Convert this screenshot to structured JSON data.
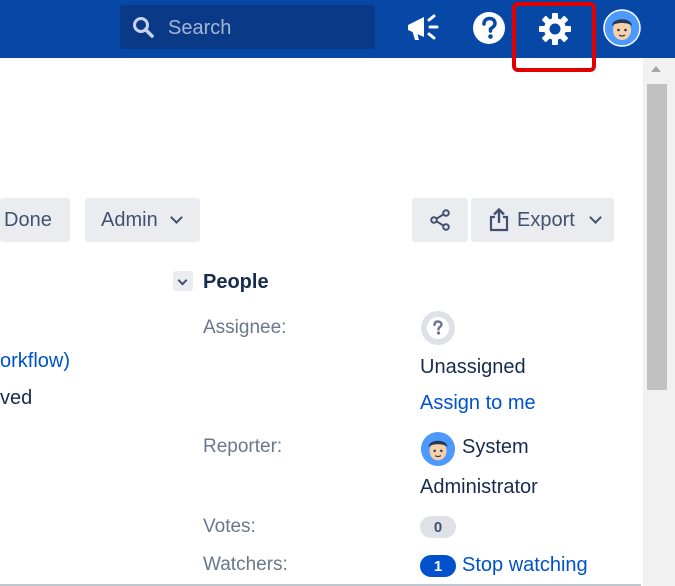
{
  "topbar": {
    "search": {
      "placeholder": "Search"
    },
    "icons": {
      "announcements": "megaphone-icon",
      "help": "help-icon",
      "settings": "gear-icon",
      "profile": "avatar"
    }
  },
  "toolbar": {
    "done_label": "Done",
    "admin_label": "Admin",
    "export_label": "Export"
  },
  "details": {
    "workflow_fragment": "orkflow)",
    "resolved_fragment": "ved"
  },
  "people": {
    "title": "People",
    "assignee_label": "Assignee:",
    "assignee_value": "Unassigned",
    "assign_link": "Assign to me",
    "reporter_label": "Reporter:",
    "reporter_name_line1": "System",
    "reporter_name_line2": "Administrator",
    "votes_label": "Votes:",
    "votes_count": "0",
    "watchers_label": "Watchers:",
    "watchers_count": "1",
    "stop_watching": "Stop watching"
  },
  "colors": {
    "nav_bg": "#0747a6",
    "link": "#0052cc",
    "highlight": "#e00000"
  }
}
